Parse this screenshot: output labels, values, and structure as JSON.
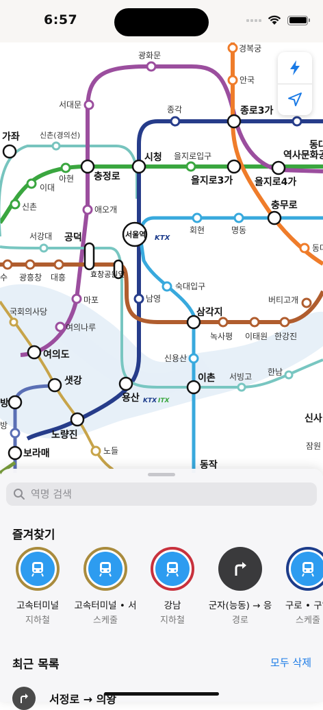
{
  "status": {
    "time": "6:57"
  },
  "map_labels": {
    "gyeongbokgung": "경복궁",
    "gwanghwamun": "광화문",
    "anguk": "안국",
    "seodaemun": "서대문",
    "jonggak": "종각",
    "jongno3ga": "종로3가",
    "gajwa": "가좌",
    "sinchon_gyeongui": "신촌(경의선)",
    "dong_top": "동대",
    "history_park": "역사문화공",
    "city_hall": "시청",
    "euljiro1ga": "을지로입구",
    "euljiro3ga": "을지로3가",
    "euljiro4ga": "을지로4가",
    "chungjeongno": "충정로",
    "ahyeon": "아현",
    "ewha": "이대",
    "aeogae": "애오개",
    "sinchon": "신촌",
    "chungmuro": "충무로",
    "seoul_station": "서울역",
    "ktx": "KTX",
    "hoehyeon": "회현",
    "myeongdong": "명동",
    "seogangdae": "서강대",
    "gongdeok": "공덕",
    "dong_right": "동대",
    "su": "수",
    "gwangheungchang": "광흥창",
    "daeheung": "대흥",
    "hyochang": "효창공원앞",
    "sookmyung": "숙대입구",
    "beotigogae": "버티고개",
    "mapo": "마포",
    "namyeong": "남영",
    "national_assembly": "국회의사당",
    "samgakji": "삼각지",
    "yeouinaru": "여의나루",
    "noksapyeong": "녹사평",
    "itaewon": "이태원",
    "hangangjin": "한강진",
    "yeouido": "여의도",
    "sinyongsan": "신용산",
    "hannam": "한남",
    "saetgang": "샛강",
    "ichon": "이촌",
    "seobinggo": "서빙고",
    "yongsan": "용산",
    "itx": "ITX",
    "bang": "방",
    "bang2": "방",
    "noryangjin": "노량진",
    "sinsa": "신사",
    "jamwon": "잠원",
    "boramae": "보라매",
    "nodeul": "노들",
    "dongjak": "동작"
  },
  "sheet": {
    "search_placeholder": "역명 검색",
    "favorites_title": "즐겨찾기",
    "favorites": [
      {
        "name": "고속터미널",
        "sub": "지하철",
        "ring": "#a98b3d",
        "icon": "subway-icon"
      },
      {
        "name": "고속터미널 • 서",
        "sub": "스케줄",
        "ring": "#a98b3d",
        "icon": "subway-icon"
      },
      {
        "name": "강남",
        "sub": "지하철",
        "ring": "#c8313d",
        "icon": "subway-icon"
      },
      {
        "name": "군자(능동) → 응",
        "sub": "경로",
        "ring": "#3a3a3c",
        "icon": "route-arrow-icon"
      },
      {
        "name": "구로 • 구일",
        "sub": "스케줄",
        "ring": "#1c3c8a",
        "icon": "subway-icon"
      }
    ],
    "recent_title": "최근 목록",
    "see_all": "모두 삭제",
    "recent_item": "서정로 → 의왕"
  }
}
